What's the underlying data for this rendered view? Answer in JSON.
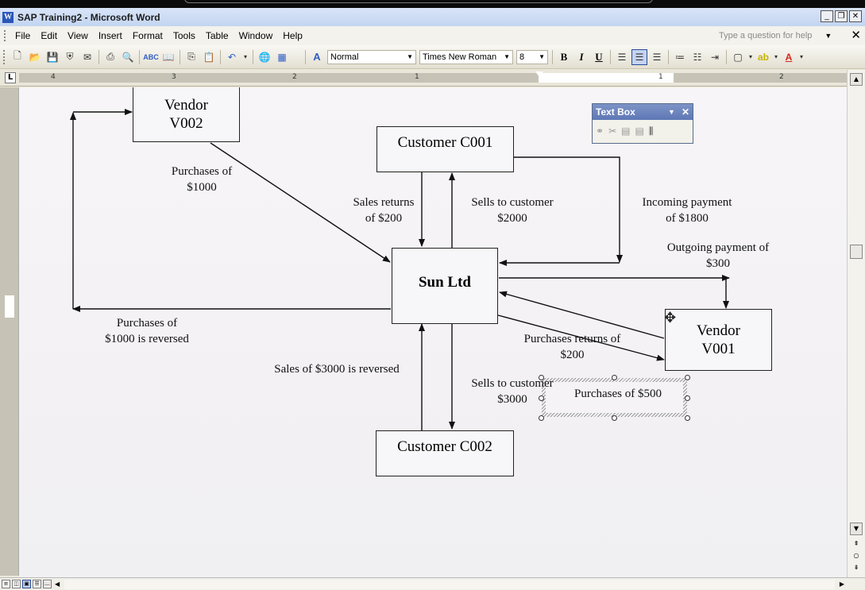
{
  "window": {
    "title": "SAP Training2 - Microsoft Word",
    "app_icon": "W"
  },
  "menu": {
    "items": [
      "File",
      "Edit",
      "View",
      "Insert",
      "Format",
      "Tools",
      "Table",
      "Window",
      "Help"
    ],
    "help_placeholder": "Type a question for help"
  },
  "toolbar": {
    "style": "Normal",
    "font": "Times New Roman",
    "size": "8",
    "bold": "B",
    "italic": "I",
    "underline": "U",
    "active_align": "center"
  },
  "ruler": {
    "numbers": [
      "4",
      "3",
      "2",
      "1",
      "1",
      "2"
    ]
  },
  "textbox_toolbar": {
    "title": "Text Box"
  },
  "diagram": {
    "boxes": {
      "vendor_v002": "Vendor\nV002",
      "customer_c001": "Customer C001",
      "sun_ltd": "Sun Ltd",
      "vendor_v001": "Vendor\nV001",
      "customer_c002": "Customer C002"
    },
    "labels": {
      "purchases_1000": "Purchases of\n$1000",
      "sales_returns_200": "Sales returns\nof $200",
      "sells_2000": "Sells to customer\n$2000",
      "incoming_1800": "Incoming payment\nof $1800",
      "outgoing_300": "Outgoing payment of\n$300",
      "purchases_500": "Purchases of $500",
      "purchases_returns_200": "Purchases returns of\n$200",
      "purchases_1000_reversed": "Purchases of\n$1000 is reversed",
      "sales_3000_reversed": "Sales of $3000 is reversed",
      "sells_3000": "Sells to customer\n$3000"
    }
  }
}
